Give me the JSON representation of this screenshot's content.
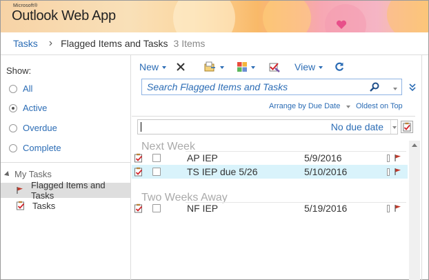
{
  "header": {
    "brand_small": "Microsoft®",
    "brand_name": "Outlook Web App"
  },
  "breadcrumb": {
    "root": "Tasks",
    "current": "Flagged Items and Tasks",
    "count": "3 Items"
  },
  "sidebar": {
    "show_label": "Show:",
    "filters": [
      {
        "label": "All",
        "selected": false
      },
      {
        "label": "Active",
        "selected": true
      },
      {
        "label": "Overdue",
        "selected": false
      },
      {
        "label": "Complete",
        "selected": false
      }
    ],
    "group_label": "My Tasks",
    "folders": [
      {
        "label": "Flagged Items and Tasks",
        "selected": true,
        "icon": "flag-icon"
      },
      {
        "label": "Tasks",
        "selected": false,
        "icon": "task-icon"
      }
    ]
  },
  "toolbar": {
    "new_label": "New",
    "view_label": "View"
  },
  "search": {
    "placeholder": "Search Flagged Items and Tasks"
  },
  "sort": {
    "arrange_label": "Arrange by Due Date",
    "order_label": "Oldest on Top"
  },
  "new_task": {
    "due_label": "No due date"
  },
  "groups": [
    {
      "label": "Next Week",
      "tasks": [
        {
          "subject": "AP IEP",
          "due": "5/9/2016",
          "highlighted": false
        },
        {
          "subject": "TS IEP due 5/26",
          "due": "5/10/2016",
          "highlighted": true
        }
      ]
    },
    {
      "label": "Two Weeks Away",
      "tasks": [
        {
          "subject": "NF IEP",
          "due": "5/19/2016",
          "highlighted": false
        }
      ]
    }
  ],
  "colors": {
    "accent": "#2b6cb5",
    "selection": "#d9f3fb",
    "flag": "#c0392b"
  }
}
